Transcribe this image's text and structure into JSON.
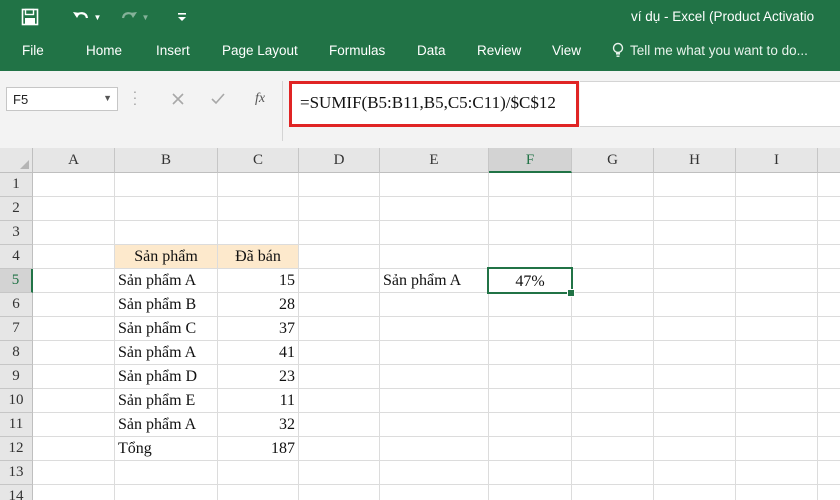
{
  "titlebar": {
    "window_title": "ví dụ - Excel (Product Activatio",
    "save_icon": "save-icon",
    "undo_icon": "undo-icon",
    "redo_icon": "redo-icon",
    "customize_icon": "customize-toolbar-icon"
  },
  "ribbon": {
    "tabs": [
      "File",
      "Home",
      "Insert",
      "Page Layout",
      "Formulas",
      "Data",
      "Review",
      "View"
    ],
    "tell_me": "Tell me what you want to do..."
  },
  "formula_bar": {
    "name_box": "F5",
    "formula": "=SUMIF(B5:B11,B5,C5:C11)/$C$12",
    "fx_label": "fx",
    "highlight_color": "#e02424"
  },
  "sheet": {
    "columns": [
      "A",
      "B",
      "C",
      "D",
      "E",
      "F",
      "G",
      "H",
      "I"
    ],
    "rows": [
      "1",
      "2",
      "3",
      "4",
      "5",
      "6",
      "7",
      "8",
      "9",
      "10",
      "11",
      "12",
      "13",
      "14"
    ],
    "active_cell": "F5",
    "header_product": "Sản phẩm",
    "header_sold": "Đã bán",
    "products": [
      "Sản phẩm A",
      "Sản phẩm B",
      "Sản phẩm C",
      "Sản phẩm A",
      "Sản phẩm D",
      "Sản phẩm E",
      "Sản phẩm A"
    ],
    "sold": [
      "15",
      "28",
      "37",
      "41",
      "23",
      "11",
      "32"
    ],
    "total_label": "Tổng",
    "total_value": "187",
    "lookup_label": "Sản phẩm A",
    "result": "47%"
  },
  "colors": {
    "excel_green": "#217346",
    "header_fill": "#fde9cc"
  }
}
